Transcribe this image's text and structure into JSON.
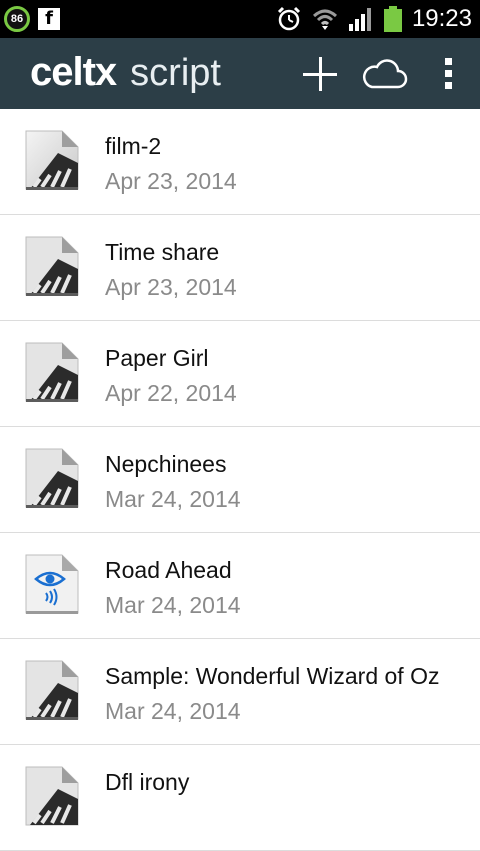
{
  "status_bar": {
    "battery_badge": "86",
    "fb_icon": "facebook-icon",
    "time": "19:23"
  },
  "action_bar": {
    "brand": "celtx",
    "product": "script",
    "add_icon": "plus-icon",
    "cloud_icon": "cloud-icon",
    "menu_icon": "overflow-menu-icon"
  },
  "files": [
    {
      "title": "film-2",
      "date": "Apr 23, 2014",
      "icon": "script-icon"
    },
    {
      "title": "Time share",
      "date": "Apr 23, 2014",
      "icon": "script-icon"
    },
    {
      "title": "Paper Girl",
      "date": "Apr 22, 2014",
      "icon": "script-icon"
    },
    {
      "title": "Nepchinees",
      "date": "Mar 24, 2014",
      "icon": "script-icon"
    },
    {
      "title": "Road Ahead",
      "date": "Mar 24, 2014",
      "icon": "av-script-icon"
    },
    {
      "title": "Sample: Wonderful Wizard of Oz",
      "date": "Mar 24, 2014",
      "icon": "script-icon"
    },
    {
      "title": "Dfl irony",
      "date": "",
      "icon": "script-icon"
    }
  ],
  "colors": {
    "action_bar": "#2c3e47",
    "battery": "#7ac943",
    "date_text": "#8a8a8a",
    "av_icon_blue": "#1a6fd1"
  }
}
